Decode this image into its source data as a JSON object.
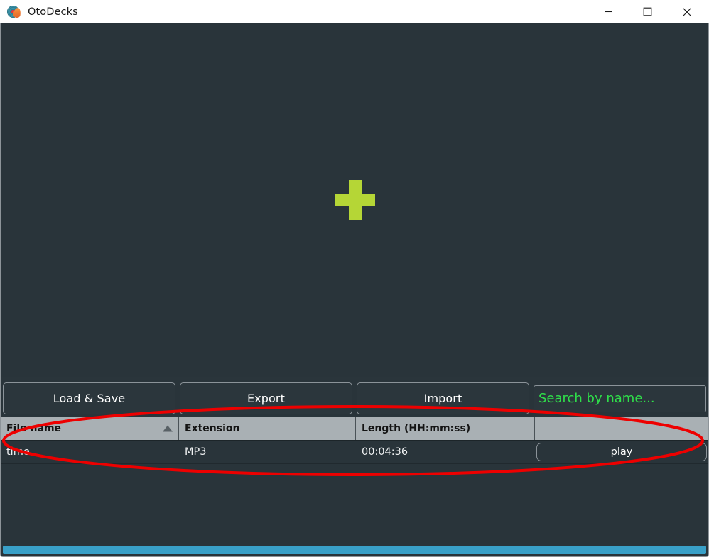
{
  "window": {
    "title": "OtoDecks",
    "icon": "vinyl-record-flame-icon",
    "controls": {
      "minimize": "minimize-icon",
      "maximize": "maximize-icon",
      "close": "close-icon"
    }
  },
  "deck": {
    "drop_icon": "plus-icon",
    "plus_color": "#b5d636",
    "background_color": "#29343a"
  },
  "toolbar": {
    "load_save_label": "Load & Save",
    "export_label": "Export",
    "import_label": "Import",
    "search_placeholder": "Search by name...",
    "search_value": "",
    "search_text_color": "#2fe04a"
  },
  "table": {
    "columns": [
      {
        "label": "File name",
        "sort": "ascending"
      },
      {
        "label": "Extension",
        "sort": "none"
      },
      {
        "label": "Length (HH:mm:ss)",
        "sort": "none"
      },
      {
        "label": "",
        "sort": "none"
      }
    ],
    "rows": [
      {
        "file_name": "time",
        "extension": "MP3",
        "length": "00:04:36",
        "action_label": "play"
      }
    ]
  },
  "scrollbar": {
    "orientation": "horizontal",
    "color": "#39a0c8"
  },
  "annotation": {
    "shape": "ellipse",
    "color": "#ee0000",
    "target": "music-library-table"
  }
}
